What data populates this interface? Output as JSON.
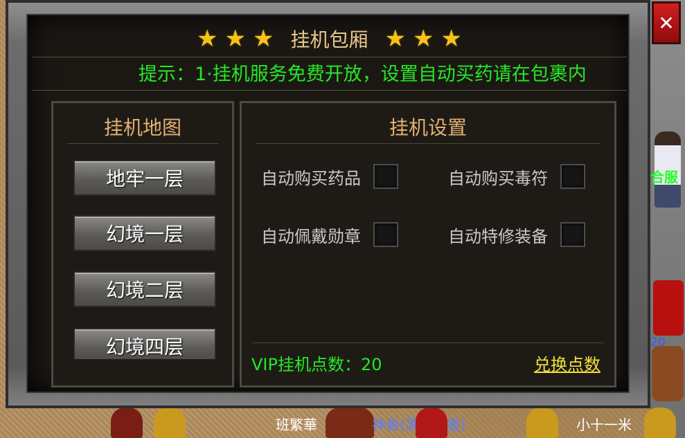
{
  "window": {
    "title": "挂机包厢",
    "notice": "提示：1·挂机服务免费开放，设置自动买药请在包裹内",
    "close_label": "✕"
  },
  "title_stars": [
    "★",
    "★",
    "★",
    "★",
    "★",
    "★"
  ],
  "left": {
    "heading": "挂机地图",
    "maps": [
      "地牢一层",
      "幻境一层",
      "幻境二层",
      "幻境四层"
    ]
  },
  "right": {
    "heading": "挂机设置",
    "options": [
      {
        "label": "自动购买药品",
        "checked": false
      },
      {
        "label": "自动购买毒符",
        "checked": false
      },
      {
        "label": "自动佩戴勋章",
        "checked": false
      },
      {
        "label": "自动特修装备",
        "checked": false
      }
    ],
    "vip_label": "VIP挂机点数：20",
    "exchange_label": "兑换点数"
  },
  "scene": {
    "right_tag": "合服",
    "right_num": "20_",
    "npc_names": [
      "班繁華",
      "神兽(落叶残香)",
      "小十一米"
    ]
  },
  "colors": {
    "notice": "#25e825",
    "title": "#e8c98f",
    "heading": "#e3b070",
    "exchange": "#f2e13a",
    "close": "#d21f1f"
  }
}
